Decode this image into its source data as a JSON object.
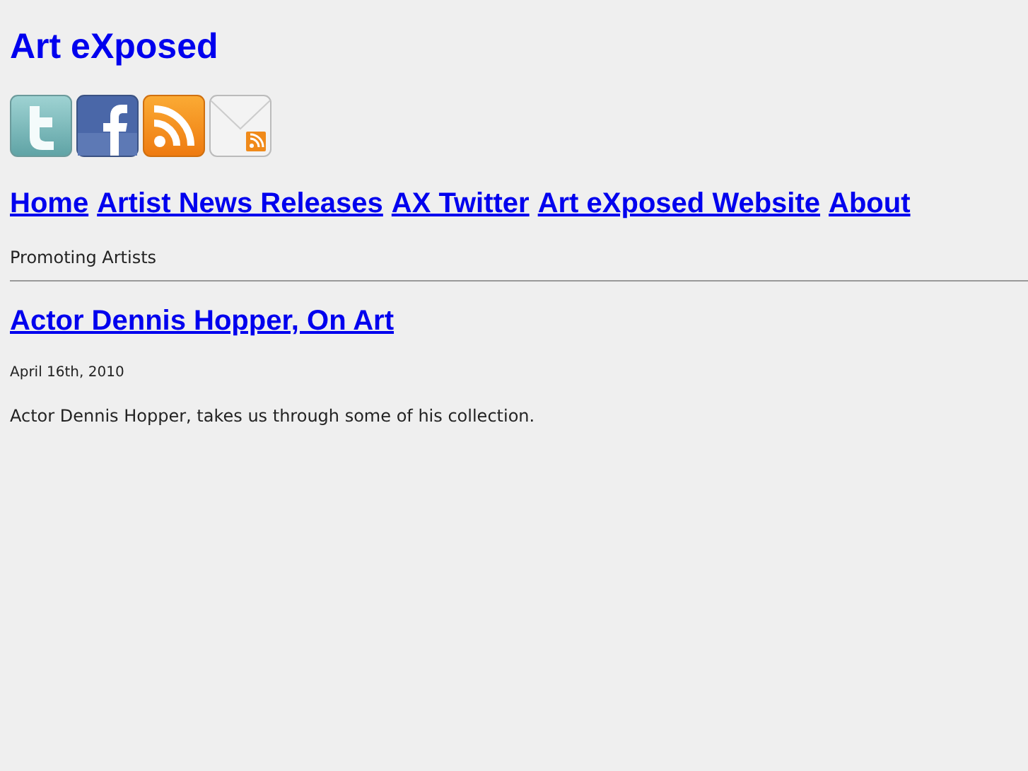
{
  "site_title": "Art eXposed",
  "social_icons": [
    {
      "kind": "twitter"
    },
    {
      "kind": "facebook"
    },
    {
      "kind": "rss"
    },
    {
      "kind": "email"
    }
  ],
  "nav": [
    "Home",
    "Artist News Releases",
    "AX Twitter",
    "Art eXposed Website",
    "About"
  ],
  "tagline": "Promoting Artists",
  "post": {
    "title": "Actor Dennis Hopper, On Art",
    "date": "April 16th, 2010",
    "excerpt": "Actor Dennis Hopper, takes us through some of his collection."
  }
}
